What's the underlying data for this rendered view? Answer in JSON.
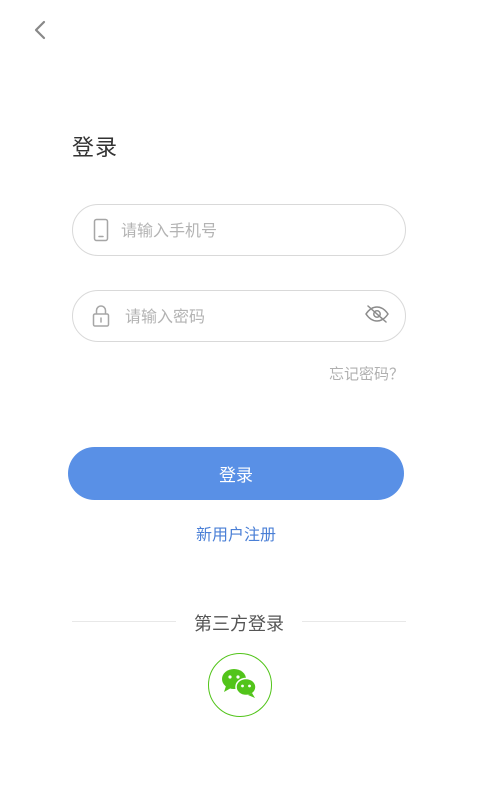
{
  "nav": {
    "back_icon": "chevron-left-icon"
  },
  "page": {
    "title": "登录"
  },
  "phone_field": {
    "placeholder": "请输入手机号",
    "value": "",
    "icon": "phone-icon"
  },
  "password_field": {
    "placeholder": "请输入密码",
    "value": "",
    "icon": "lock-icon",
    "toggle_icon": "eye-off-icon"
  },
  "links": {
    "forgot_password": "忘记密码？",
    "register": "新用户注册"
  },
  "login_button": {
    "label": "登录"
  },
  "third_party": {
    "label": "第三方登录",
    "providers": [
      {
        "icon": "wechat-icon",
        "color": "#52c41a"
      }
    ]
  },
  "colors": {
    "primary": "#5990e6",
    "link": "#4a7fd6",
    "wechat": "#52c41a",
    "border": "#d9d9d9"
  }
}
